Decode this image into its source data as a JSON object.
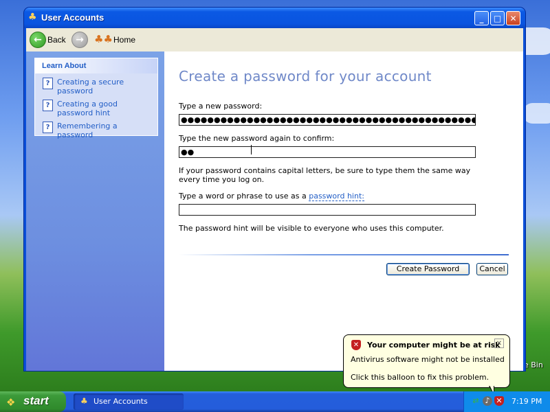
{
  "window": {
    "title": "User Accounts",
    "icon": "users-icon",
    "controls": {
      "minimize": "_",
      "maximize": "□",
      "close": "✕"
    }
  },
  "toolbar": {
    "back_label": "Back",
    "back_icon_glyph": "←",
    "forward_icon_glyph": "→",
    "home_label": "Home"
  },
  "sidebar": {
    "learn_about_title": "Learn About",
    "help_glyph": "?",
    "items": [
      {
        "label": "Creating a secure password"
      },
      {
        "label": "Creating a good password hint"
      },
      {
        "label": "Remembering a password"
      }
    ]
  },
  "main": {
    "heading": "Create a password for your account",
    "new_password_label": "Type a new password:",
    "new_password_value": "●●●●●●●●●●●●●●●●●●●●●●●●●●●●●●●●●●●●●●●●●●●●●●●●●●●",
    "confirm_label": "Type the new password again to confirm:",
    "confirm_value": "●●",
    "help_text": "If your password contains capital letters, be sure to type them the same way every time you log on.",
    "hint_label_prefix": "Type a word or phrase to use as a",
    "hint_link": "password hint:",
    "hint_value": "",
    "hint_visible_note": "The password hint will be visible to everyone who uses this computer.",
    "create_button": "Create Password",
    "cancel_button": "Cancel"
  },
  "balloon": {
    "title": "Your computer might be at risk",
    "line1": "Antivirus software might not be installed",
    "line2": "Click this balloon to fix this problem.",
    "close_glyph": "✕",
    "icon": "security-shield-icon"
  },
  "desktop": {
    "recycle_bin_partial": "e Bin"
  },
  "taskbar": {
    "start_label": "start",
    "task_label": "User Accounts",
    "clock": "7:19 PM",
    "tray_icons": [
      "network-icon",
      "volume-icon",
      "security-alert-icon"
    ]
  },
  "colors": {
    "titlebar": "#0a54df",
    "sidebar": "#6d8fe0",
    "heading": "#6f88c8",
    "link": "#215dc6",
    "balloon_bg": "#ffffe1",
    "start_green": "#3c9a39",
    "taskbar_blue": "#245edb"
  }
}
